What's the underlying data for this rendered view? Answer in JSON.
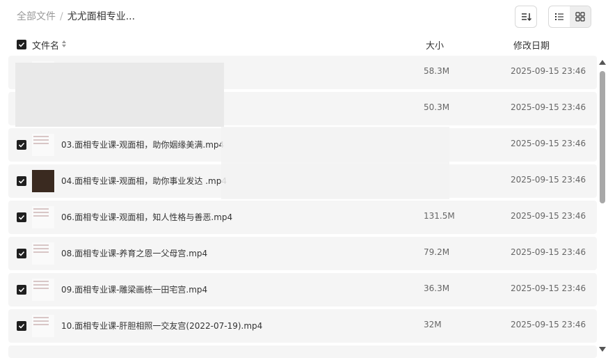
{
  "breadcrumb": {
    "root": "全部文件",
    "separator": "/",
    "current": "尤尤面相专业..."
  },
  "header": {
    "name": "文件名",
    "size": "大小",
    "date": "修改日期"
  },
  "files": [
    {
      "name": "",
      "size": "58.3M",
      "date": "2025-09-15 23:46",
      "thumb": "blurred"
    },
    {
      "name": "",
      "size": "50.3M",
      "date": "2025-09-15 23:46",
      "thumb": "blurred"
    },
    {
      "name": "03.面相专业课-观面相，助你姻缘美满.mp4",
      "size": "",
      "date": "2025-09-15 23:46",
      "thumb": "face-doc"
    },
    {
      "name": "04.面相专业课-观面相，助你事业发达 .mp4",
      "size": "",
      "date": "2025-09-15 23:46",
      "thumb": "dark-video"
    },
    {
      "name": "06.面相专业课-观面相，知人性格与善恶.mp4",
      "size": "131.5M",
      "date": "2025-09-15 23:46",
      "thumb": "doc"
    },
    {
      "name": "08.面相专业课-养育之恩一父母宫.mp4",
      "size": "79.2M",
      "date": "2025-09-15 23:46",
      "thumb": "doc"
    },
    {
      "name": "09.面相专业课-雕梁画栋一田宅宫.mp4",
      "size": "36.3M",
      "date": "2025-09-15 23:46",
      "thumb": "doc"
    },
    {
      "name": "10.面相专业课-肝胆相照一交友宫(2022-07-19).mp4",
      "size": "32M",
      "date": "2025-09-15 23:46",
      "thumb": "doc"
    }
  ],
  "icons": {
    "sort": "sort-icon",
    "list_view": "list-view-icon",
    "grid_view": "grid-view-icon"
  },
  "colors": {
    "row_bg": "#f5f5f5",
    "checkbox": "#1f1f1f",
    "scroll_thumb": "#a8a8a8"
  }
}
